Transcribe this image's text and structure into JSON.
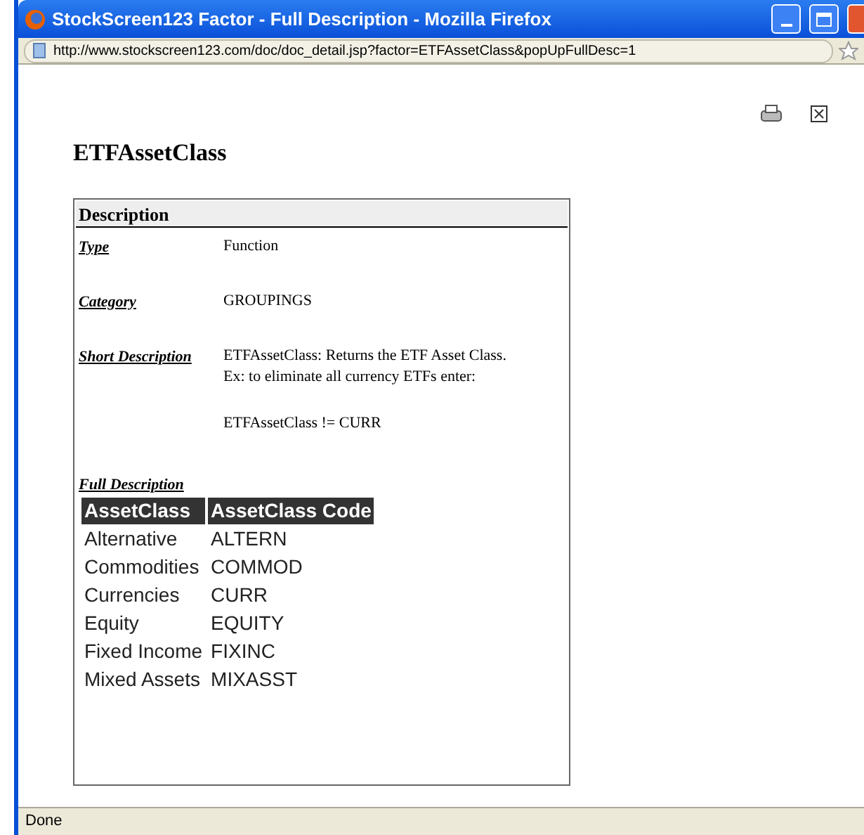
{
  "window": {
    "title": "StockScreen123 Factor - Full Description - Mozilla Firefox"
  },
  "address_bar": {
    "url": "http://www.stockscreen123.com/doc/doc_detail.jsp?factor=ETFAssetClass&popUpFullDesc=1"
  },
  "page": {
    "heading": "ETFAssetClass",
    "section_title": "Description",
    "fields": [
      {
        "label": "Type",
        "paragraphs": [
          [
            "Function"
          ]
        ]
      },
      {
        "label": "Category",
        "paragraphs": [
          [
            "GROUPINGS"
          ]
        ]
      },
      {
        "label": "Short Description",
        "paragraphs": [
          [
            "ETFAssetClass: Returns the ETF Asset Class.",
            "Ex: to eliminate all currency ETFs enter:"
          ],
          [
            "ETFAssetClass != CURR"
          ]
        ]
      }
    ],
    "full_description_label": "Full Description",
    "table": {
      "columns": [
        "AssetClass",
        "AssetClass Code"
      ],
      "rows": [
        [
          "Alternative",
          "ALTERN"
        ],
        [
          "Commodities",
          "COMMOD"
        ],
        [
          "Currencies",
          "CURR"
        ],
        [
          "Equity",
          "EQUITY"
        ],
        [
          "Fixed Income",
          "FIXINC"
        ],
        [
          "Mixed Assets",
          "MIXASST"
        ]
      ]
    }
  },
  "status_bar": {
    "text": "Done"
  }
}
